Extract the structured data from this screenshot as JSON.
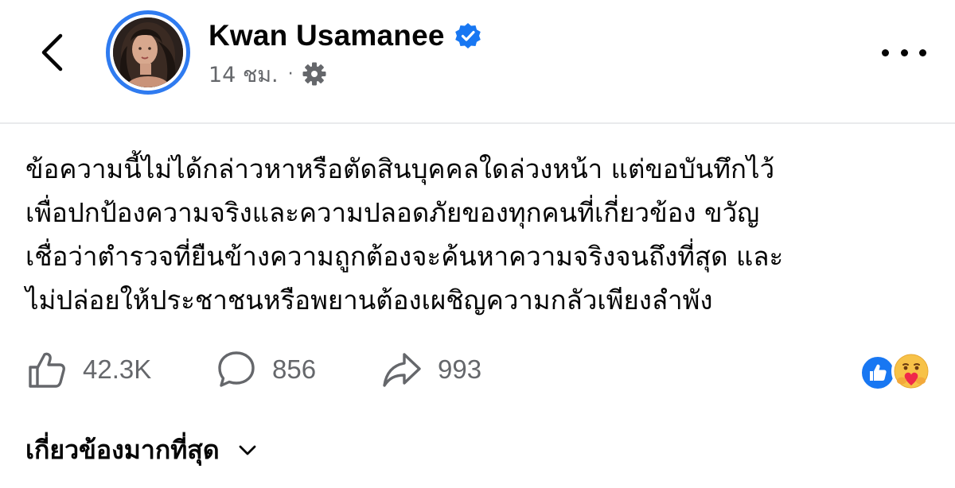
{
  "header": {
    "back_icon": "chevron-left-icon",
    "author_name": "Kwan Usamanee",
    "verified_icon": "verified-badge-icon",
    "timestamp": "14 ชม.",
    "separator": "·",
    "privacy_icon": "gear-icon",
    "more_icon": "more-horizontal-icon"
  },
  "post": {
    "lines": [
      "ข้อความนี้ไม่ได้กล่าวหาหรือตัดสินบุคคลใดล่วงหน้า แต่ขอบันทึกไว้",
      "เพื่อปกป้องความจริงและความปลอดภัยของทุกคนที่เกี่ยวข้อง ขวัญ",
      "เชื่อว่าตำรวจที่ยืนข้างความถูกต้องจะค้นหาความจริงจนถึงที่สุด และ",
      "ไม่ปล่อยให้ประชาชนหรือพยานต้องเผชิญความกลัวเพียงลำพัง"
    ]
  },
  "actions": {
    "like_count": "42.3K",
    "comment_count": "856",
    "share_count": "993",
    "like_icon": "thumbs-up-icon",
    "comment_icon": "comment-bubble-icon",
    "share_icon": "share-arrow-icon"
  },
  "reactions": {
    "icons": [
      "like-reaction-icon",
      "care-reaction-icon"
    ]
  },
  "comments": {
    "sort_label": "เกี่ยวข้องมากที่สุด",
    "sort_icon": "chevron-down-icon"
  },
  "colors": {
    "accent": "#1877f2",
    "ring": "#2f7bf0",
    "text": "#050505",
    "muted": "#65676b",
    "divider": "#e9eaec"
  }
}
